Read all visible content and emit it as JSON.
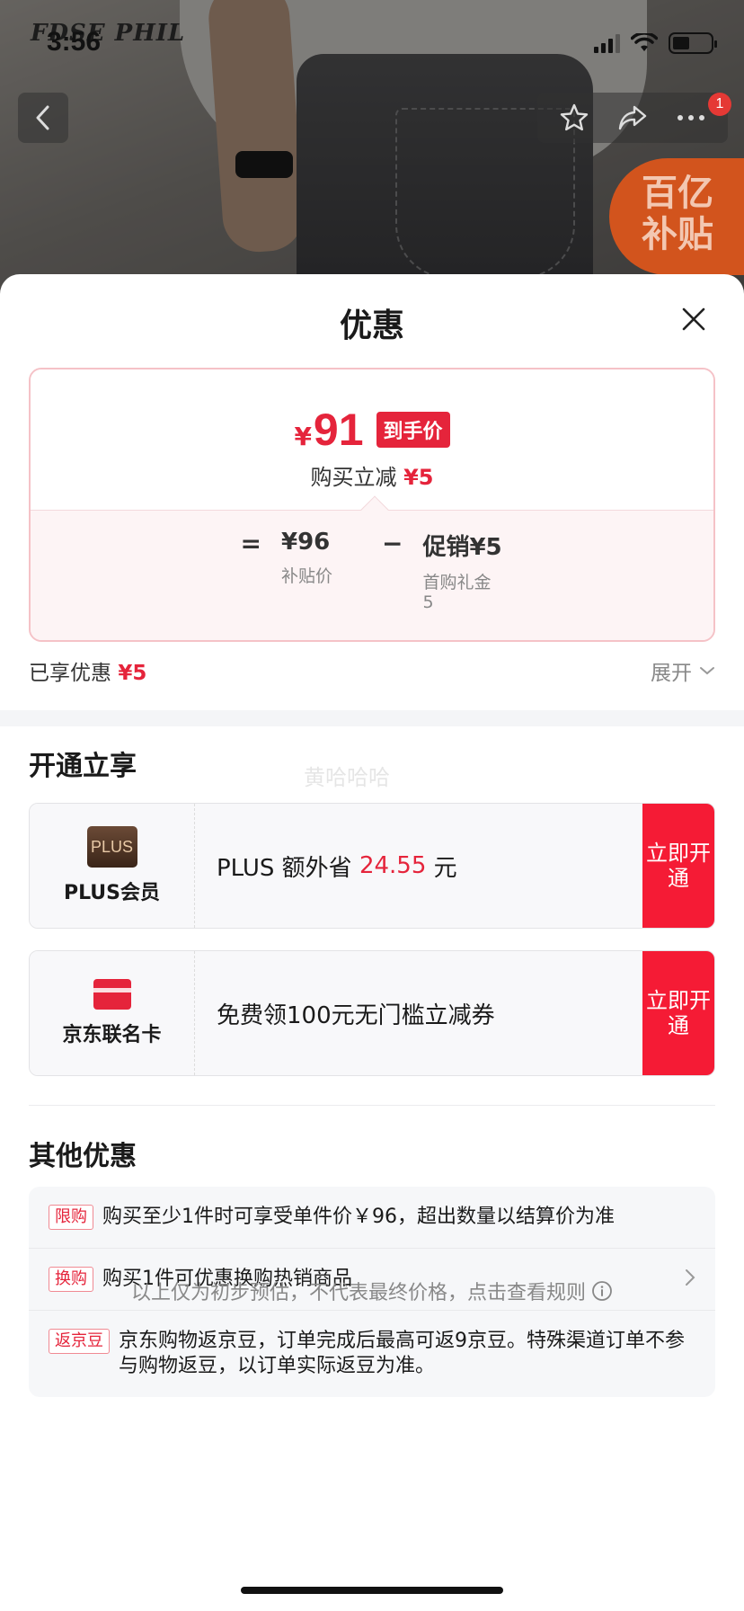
{
  "background": {
    "brand_logo": "FDSE PHIL",
    "status_time": "3:56",
    "notification_count": "1",
    "subsidy_badge": [
      "百亿",
      "补贴"
    ]
  },
  "sheet": {
    "title": "优惠",
    "price_card": {
      "currency": "¥",
      "final_price": "91",
      "final_tag": "到手价",
      "save_text": "购买立减",
      "save_amount": "¥5",
      "equals": "=",
      "base_price": "¥96",
      "base_label": "补贴价",
      "minus": "−",
      "promo": "促销¥5",
      "promo_label": "首购礼金 5"
    },
    "enjoyed": {
      "label": "已享优惠",
      "amount": "¥5",
      "expand_label": "展开"
    },
    "open_section": {
      "title": "开通立享",
      "watermark": "黄哈哈哈",
      "cards": [
        {
          "name": "PLUS会员",
          "logo_text": "PLUS",
          "desc_prefix": "PLUS 额外省 ",
          "desc_amount": "24.55",
          "desc_suffix": " 元",
          "button": "立即开通"
        },
        {
          "name": "京东联名卡",
          "desc": "免费领100元无门槛立减券",
          "button": "立即开通"
        }
      ]
    },
    "other_section": {
      "title": "其他优惠",
      "items": [
        {
          "tag": "限购",
          "text": "购买至少1件时可享受单件价￥96，超出数量以结算价为准"
        },
        {
          "tag": "换购",
          "text": "购买1件可优惠换购热销商品"
        },
        {
          "tag": "返京豆",
          "text": "京东购物返京豆，订单完成后最高可返9京豆。特殊渠道订单不参与购物返豆，以订单实际返豆为准。"
        }
      ]
    },
    "footnote": "以上仅为初步预估，不代表最终价格，点击查看规则"
  }
}
